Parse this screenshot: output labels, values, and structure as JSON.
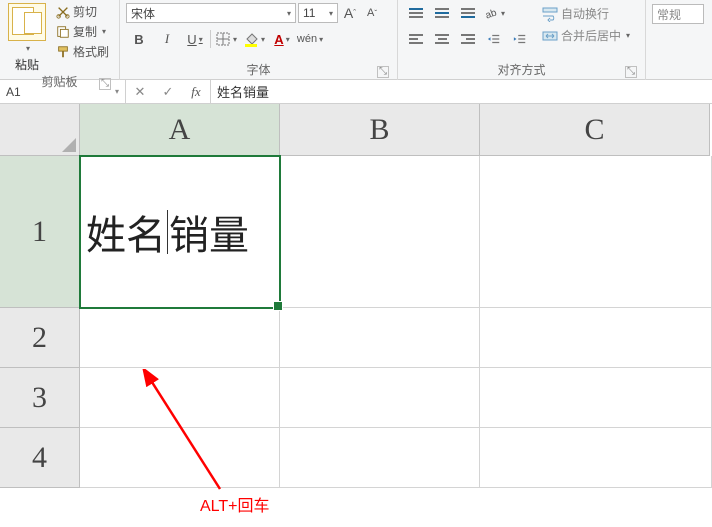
{
  "ribbon": {
    "clipboard": {
      "paste": "粘贴",
      "cut": "剪切",
      "copy": "复制",
      "format_painter": "格式刷",
      "group": "剪贴板"
    },
    "font": {
      "name": "宋体",
      "size": "11",
      "increase_hint": "A",
      "decrease_hint": "A",
      "bold": "B",
      "italic": "I",
      "underline": "U",
      "font_color_letter": "A",
      "wen": "wén",
      "group": "字体"
    },
    "align": {
      "wrap": "自动换行",
      "merge": "合并后居中",
      "group": "对齐方式"
    },
    "format": {
      "general": "常规"
    }
  },
  "formula_bar": {
    "namebox": "A1",
    "cancel": "✕",
    "enter": "✓",
    "fx": "fx",
    "value": "姓名销量"
  },
  "sheet": {
    "cols": {
      "A": "A",
      "B": "B",
      "C": "C"
    },
    "rows": {
      "r1": "1",
      "r2": "2",
      "r3": "3",
      "r4": "4"
    },
    "A1_left": "姓名",
    "A1_right": "销量"
  },
  "annotation": {
    "label": "ALT+回车"
  }
}
